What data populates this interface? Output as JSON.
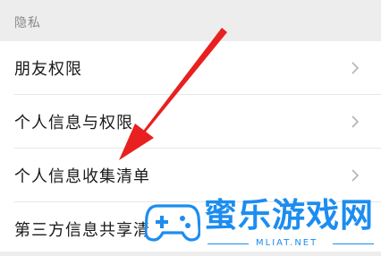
{
  "section": {
    "title": "隐私"
  },
  "rows": [
    {
      "label": "朋友权限"
    },
    {
      "label": "个人信息与权限"
    },
    {
      "label": "个人信息收集清单"
    },
    {
      "label": "第三方信息共享清"
    }
  ],
  "watermark": {
    "name": "蜜乐游戏网",
    "url": "MLIAT.NET"
  },
  "colors": {
    "arrow": "#e8201f",
    "watermark": "#1c8df0",
    "background": "#ededed"
  }
}
